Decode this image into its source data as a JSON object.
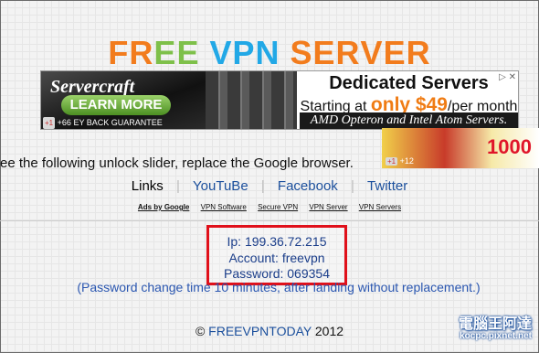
{
  "title": {
    "letters": [
      {
        "ch": "F",
        "color": "#f27c1d"
      },
      {
        "ch": "R",
        "color": "#f27c1d"
      },
      {
        "ch": "E",
        "color": "#7ec04a"
      },
      {
        "ch": "E",
        "color": "#7ec04a"
      },
      {
        "ch": " ",
        "color": "#000"
      },
      {
        "ch": "V",
        "color": "#22a8e6"
      },
      {
        "ch": "P",
        "color": "#22a8e6"
      },
      {
        "ch": "N",
        "color": "#22a8e6"
      },
      {
        "ch": " ",
        "color": "#000"
      },
      {
        "ch": "S",
        "color": "#f27c1d"
      },
      {
        "ch": "E",
        "color": "#f27c1d"
      },
      {
        "ch": "R",
        "color": "#f27c1d"
      },
      {
        "ch": "V",
        "color": "#f27c1d"
      },
      {
        "ch": "E",
        "color": "#f27c1d"
      },
      {
        "ch": "R",
        "color": "#f27c1d"
      }
    ]
  },
  "banner": {
    "brand": "Servercraft",
    "learn_more": "LEARN MORE",
    "g_plus": "+1",
    "g_count": "+66",
    "guarantee": "EY BACK GUARANTEE",
    "headline": "Dedicated Servers",
    "starting_prefix": "Starting at ",
    "price": "only $49",
    "price_suffix": "/per month",
    "amd": "AMD Opteron and Intel Atom Servers.",
    "close": "▷ ✕"
  },
  "slider_text": "ee the following unlock slider, replace the Google browser.",
  "side_ad": {
    "g_plus": "+1",
    "count": "+12",
    "number": "1000"
  },
  "links": {
    "label": "Links",
    "youtube": "YouTuBe",
    "facebook": "Facebook",
    "twitter": "Twitter"
  },
  "ads_bar": {
    "ads_by": "Ads by Google",
    "items": [
      "VPN Software",
      "Secure VPN",
      "VPN Server",
      "VPN Servers"
    ]
  },
  "credentials": {
    "ip": "Ip: 199.36.72.215",
    "account": "Account: freevpn",
    "password": "Password: 069354"
  },
  "password_note": "(Password change time 10 minutes, after landing without replacement.)",
  "footer": {
    "copy": "© ",
    "brand": "FREEVPNTODAY",
    "year": " 2012"
  },
  "watermark": {
    "top": "電腦王阿達",
    "bottom": "kocpc.pixnet.net"
  }
}
